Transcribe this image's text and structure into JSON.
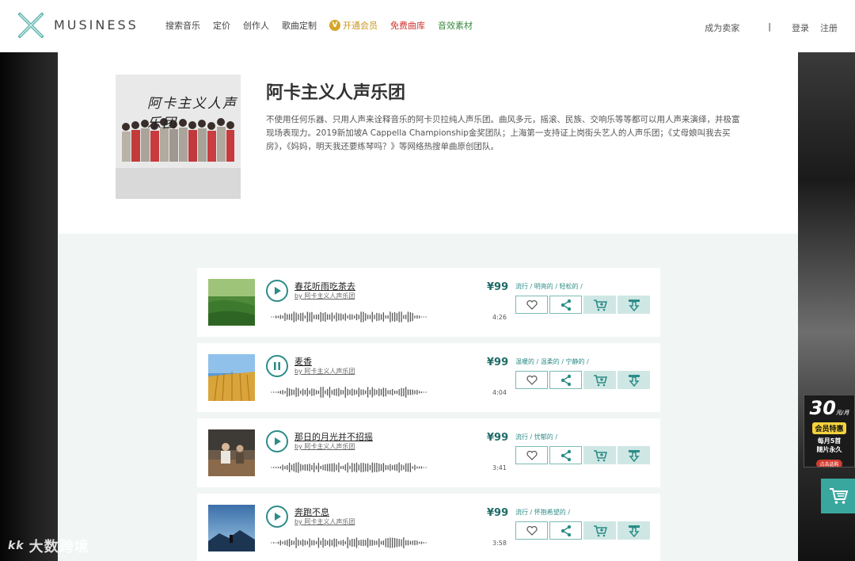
{
  "header": {
    "brand": "MUSINESS",
    "nav": [
      {
        "label": "搜索音乐"
      },
      {
        "label": "定价"
      },
      {
        "label": "创作人"
      },
      {
        "label": "歌曲定制"
      },
      {
        "label": "开通会员",
        "badge": "V"
      },
      {
        "label": "免费曲库"
      },
      {
        "label": "音效素材"
      }
    ],
    "sell_label": "成为卖家",
    "separator": "|",
    "login_label": "登录",
    "register_label": "注册"
  },
  "artist": {
    "name": "阿卡主义人声乐团",
    "cover_text": "阿卡主义人声乐团",
    "description": "不使用任何乐器、只用人声来诠释音乐的阿卡贝拉纯人声乐团。曲风多元，摇滚、民族、交响乐等等都可以用人声来演绎，并极富现场表现力。2019新加坡A Cappella Championship金奖团队；上海第一支持证上岗街头艺人的人声乐团；《丈母娘叫我去买房》，《妈妈，明天我还要练琴吗？》等网络热搜单曲原创团队。"
  },
  "tracks": [
    {
      "title": "春花听雨吃茶去",
      "artist": "by 阿卡主义人声乐团",
      "price": "¥99",
      "tags": "流行 / 明亮的 / 轻松的 /",
      "duration": "4:26",
      "state": "paused"
    },
    {
      "title": "麦香",
      "artist": "by 阿卡主义人声乐团",
      "price": "¥99",
      "tags": "温暖的 / 温柔的 / 宁静的 /",
      "duration": "4:04",
      "state": "playing"
    },
    {
      "title": "那日的月光并不招摇",
      "artist": "by 阿卡主义人声乐团",
      "price": "¥99",
      "tags": "流行 / 忧郁的 /",
      "duration": "3:41",
      "state": "paused"
    },
    {
      "title": "奔跑不息",
      "artist": "by 阿卡主义人声乐团",
      "price": "¥99",
      "tags": "流行 / 怀抱希望的 /",
      "duration": "3:58",
      "state": "paused"
    }
  ],
  "promo": {
    "number": "30",
    "unit": "元/月",
    "tag": "会员特惠",
    "line1": "每月5首",
    "line2": "随片永久",
    "button": "点击选购"
  },
  "watermark": "大数跨境",
  "watermark_mark": "kk",
  "colors": {
    "accent": "#2c8c87",
    "price": "#1f6b66",
    "cart": "#3aa79f"
  }
}
